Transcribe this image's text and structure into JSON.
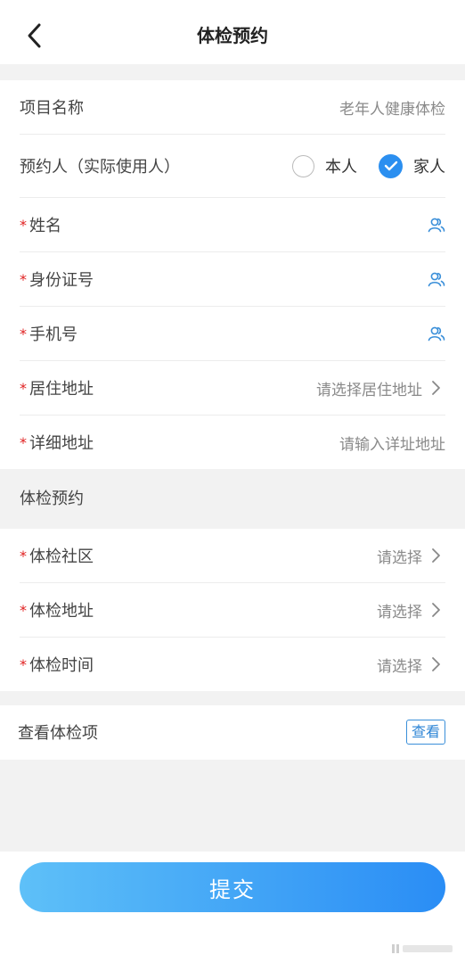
{
  "header": {
    "title": "体检预约"
  },
  "info": {
    "project_label": "项目名称",
    "project_value": "老年人健康体检",
    "booker_label": "预约人（实际使用人）",
    "option_self": "本人",
    "option_family": "家人",
    "selected_option": "家人",
    "required_mark": "*",
    "name_label": "姓名",
    "id_label": "身份证号",
    "phone_label": "手机号",
    "address_label": "居住地址",
    "address_placeholder": "请选择居住地址",
    "detail_label": "详细地址",
    "detail_placeholder": "请输入详址地址"
  },
  "exam": {
    "group_title": "体检预约",
    "community_label": "体检社区",
    "community_value": "请选择",
    "location_label": "体检地址",
    "location_value": "请选择",
    "time_label": "体检时间",
    "time_value": "请选择"
  },
  "items": {
    "label": "查看体检项",
    "button": "查看"
  },
  "submit_label": "提交",
  "icons": {
    "back": "chevron-left-icon",
    "contact": "contacts-icon",
    "chevron": "chevron-right-icon",
    "check": "check-icon"
  },
  "colors": {
    "accent": "#2b8ff0",
    "required": "#e02020",
    "submit_start": "#5ec0f8",
    "submit_end": "#2a8df5"
  }
}
